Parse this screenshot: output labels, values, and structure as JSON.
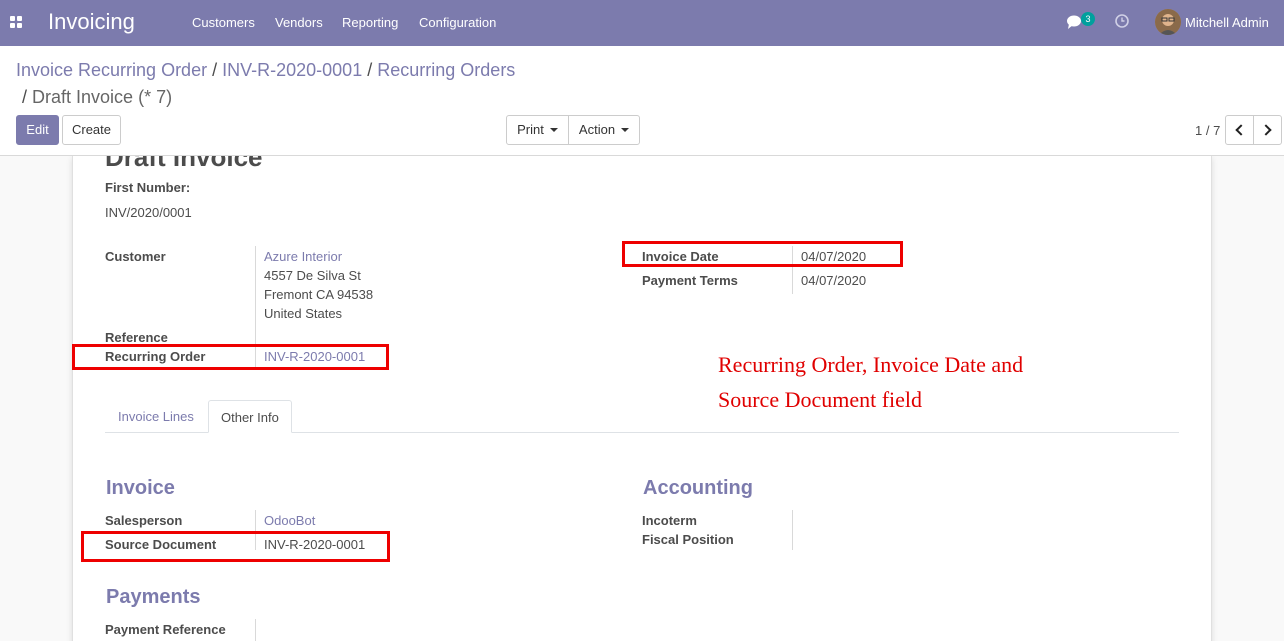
{
  "navbar": {
    "app_title": "Invoicing",
    "menu": [
      "Customers",
      "Vendors",
      "Reporting",
      "Configuration"
    ],
    "chat_badge": "3",
    "user_name": "Mitchell Admin",
    "colors": {
      "navbar": "#7c7bad",
      "badge": "#00a09d"
    }
  },
  "breadcrumb": {
    "items": [
      "Invoice Recurring Order",
      "INV-R-2020-0001",
      "Recurring Orders"
    ],
    "separator": "/",
    "active": "Draft Invoice (* 7)"
  },
  "toolbar": {
    "edit_label": "Edit",
    "create_label": "Create",
    "print_label": "Print",
    "action_label": "Action"
  },
  "pager": {
    "value": "1 / 7"
  },
  "form": {
    "title": "Draft Invoice",
    "first_number_label": "First Number:",
    "first_number_value": "INV/2020/0001",
    "customer_label": "Customer",
    "customer_name": "Azure Interior",
    "customer_address": [
      "4557 De Silva St",
      "Fremont CA 94538",
      "United States"
    ],
    "reference_label": "Reference",
    "recurring_order_label": "Recurring Order",
    "recurring_order_value": "INV-R-2020-0001",
    "invoice_date_label": "Invoice Date",
    "invoice_date_value": "04/07/2020",
    "payment_terms_label": "Payment Terms",
    "payment_terms_value": "04/07/2020"
  },
  "tabs": [
    {
      "label": "Invoice Lines",
      "active": false
    },
    {
      "label": "Other Info",
      "active": true
    }
  ],
  "other_info": {
    "invoice_section": "Invoice",
    "salesperson_label": "Salesperson",
    "salesperson_value": "OdooBot",
    "source_document_label": "Source Document",
    "source_document_value": "INV-R-2020-0001",
    "accounting_section": "Accounting",
    "incoterm_label": "Incoterm",
    "fiscal_position_label": "Fiscal Position",
    "payments_section": "Payments",
    "payment_reference_label": "Payment Reference"
  },
  "annotation": {
    "lines": [
      "Recurring Order, Invoice Date and",
      "Source Document field"
    ],
    "color": "#ee0000"
  }
}
